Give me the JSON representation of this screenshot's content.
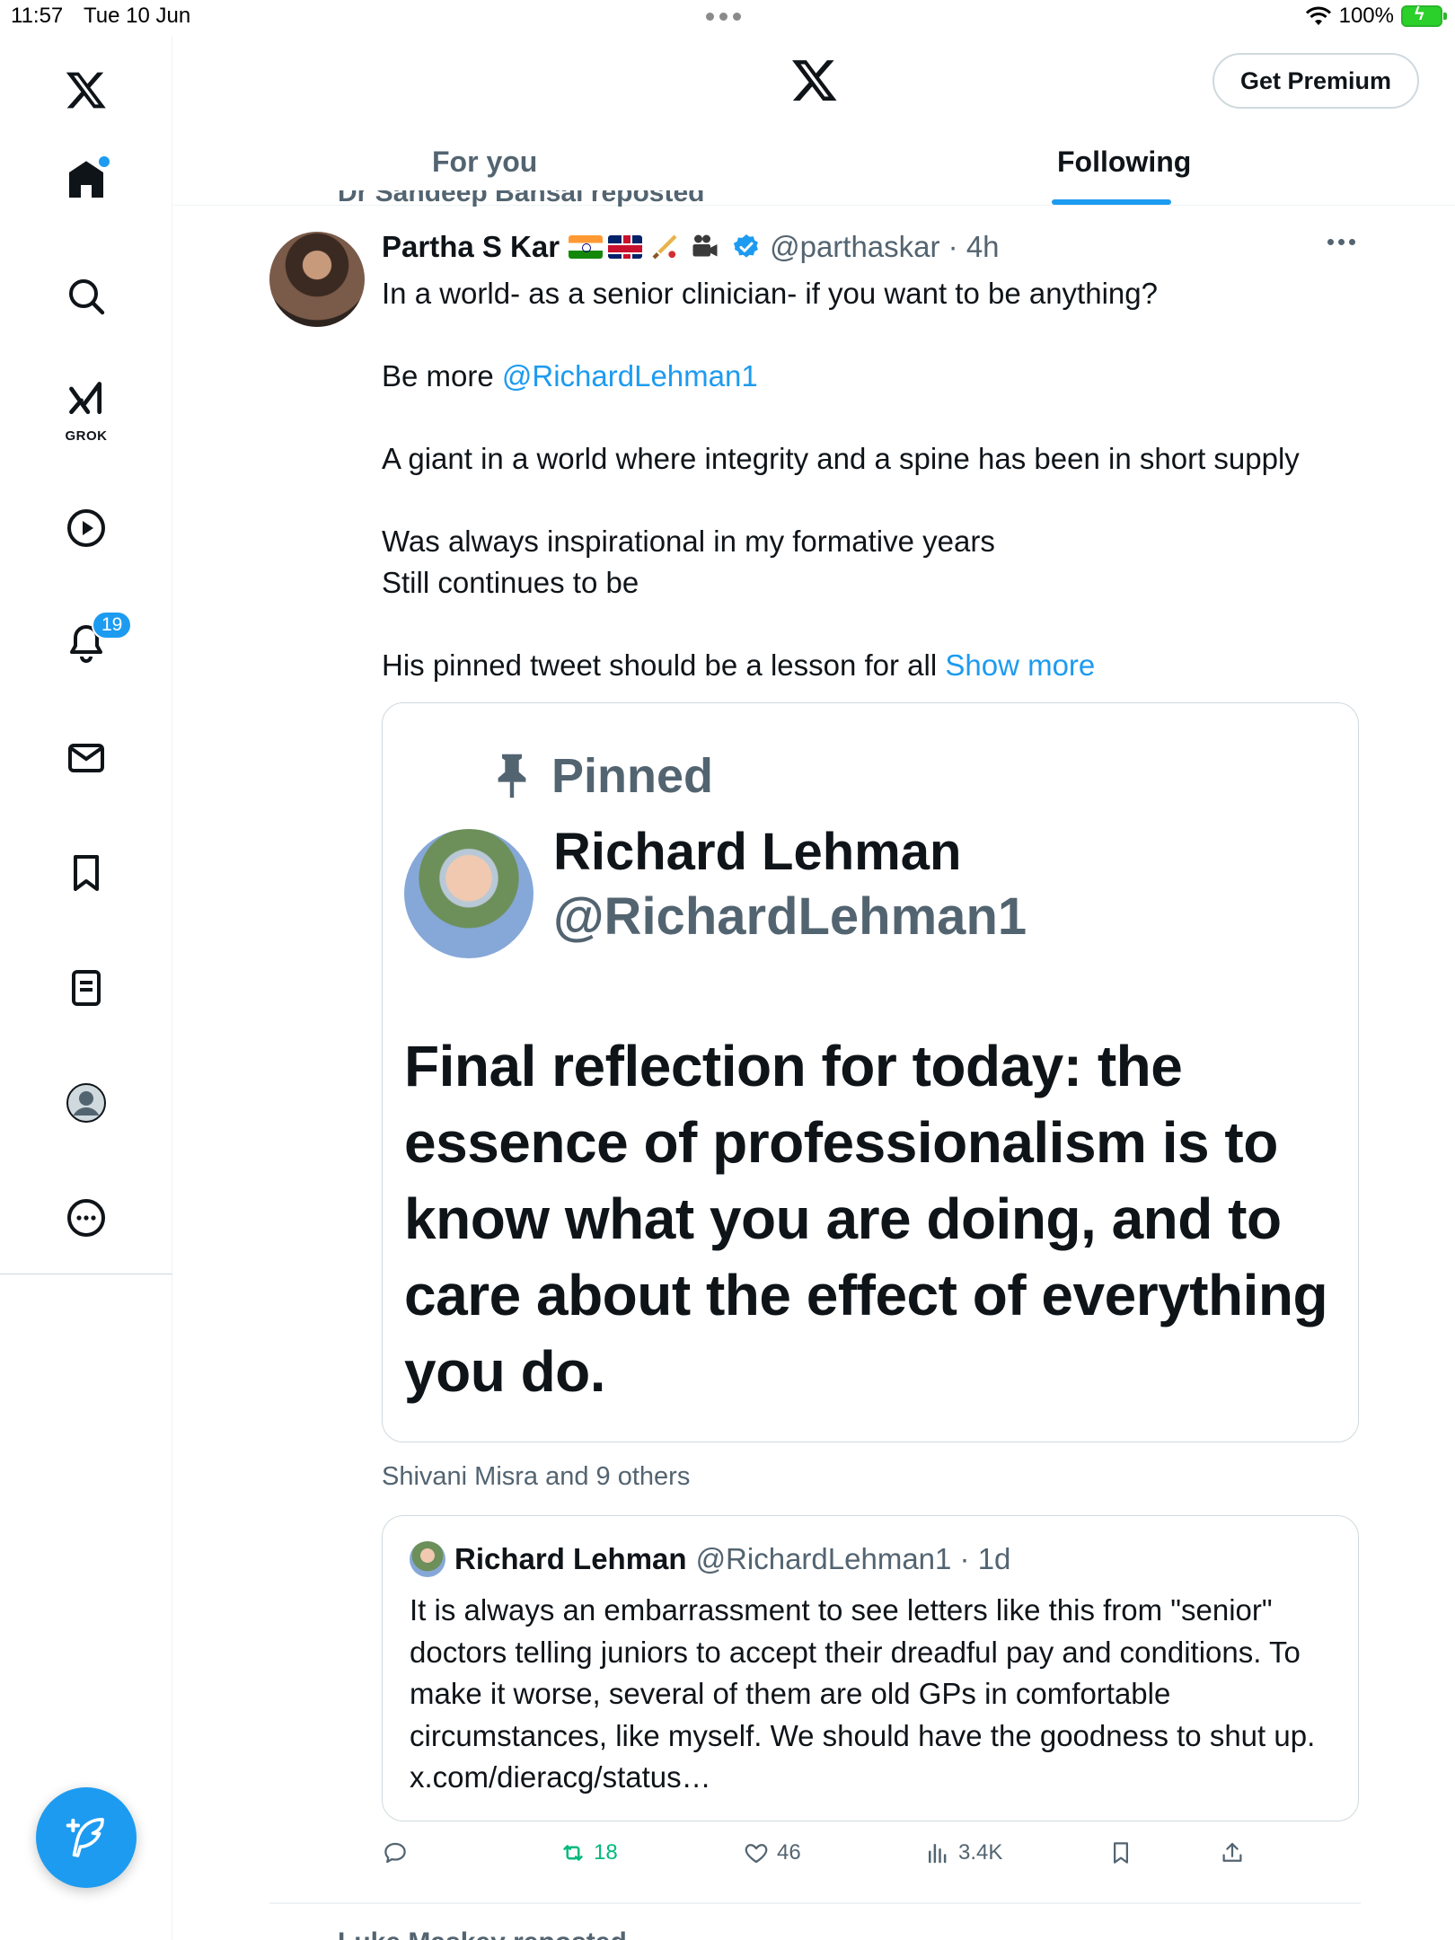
{
  "status_bar": {
    "time": "11:57",
    "date": "Tue 10 Jun",
    "battery": "100%"
  },
  "sidebar": {
    "items": [
      {
        "name": "x-logo-icon"
      },
      {
        "name": "home-icon",
        "has_notification_dot": true
      },
      {
        "name": "search-icon"
      },
      {
        "name": "grok-icon",
        "label": "GROK"
      },
      {
        "name": "video-icon"
      },
      {
        "name": "notifications-icon",
        "badge": "19"
      },
      {
        "name": "messages-icon"
      },
      {
        "name": "bookmarks-icon"
      },
      {
        "name": "lists-icon"
      },
      {
        "name": "profile-icon"
      },
      {
        "name": "more-icon"
      }
    ],
    "compose_icon": "compose-icon"
  },
  "header": {
    "premium_label": "Get Premium",
    "tabs": [
      {
        "label": "For you",
        "active": false
      },
      {
        "label": "Following",
        "active": true
      }
    ]
  },
  "tweet": {
    "reposted_by": "Dr Sandeep Bansal reposted",
    "author_name": "Partha S Kar",
    "author_handle": "@parthaskar",
    "time": "4h",
    "handle_time": "@parthaskar · 4h",
    "body_line1": "In a world- as a senior clinician- if you want to be anything?",
    "body_line2_prefix": "Be more ",
    "body_line2_mention": "@RichardLehman1",
    "body_line3": "A giant in a world where integrity and a spine has been in short supply",
    "body_line4": "Was always inspirational in my formative years",
    "body_line5": "Still continues to be",
    "body_line6": "His pinned tweet should be a lesson for all",
    "show_more": "Show more",
    "media": {
      "pinned_label": "Pinned",
      "name": "Richard Lehman",
      "handle": "@RichardLehman1",
      "quote": "Final reflection for today: the essence of professionalism is to know what you are doing, and to care about the effect of everything you do."
    },
    "social_context": "Shivani Misra and 9 others",
    "quoted": {
      "name": "Richard Lehman",
      "handle_time": "@RichardLehman1 · 1d",
      "text": "It is always an embarrassment to see letters like this from \"senior\" doctors telling juniors to accept their dreadful pay and conditions. To make it worse, several of them are old GPs in comfortable circumstances, like myself. We should have the goodness to shut up. x.com/dieracg/status…"
    },
    "actions": {
      "reply_count": "",
      "retweet_count": "18",
      "like_count": "46",
      "views_count": "3.4K"
    },
    "accent_color": "#1d9bf0",
    "retweet_color": "#00ba7c"
  },
  "next_item": {
    "reposted_by": "Luke Maskey reposted"
  }
}
